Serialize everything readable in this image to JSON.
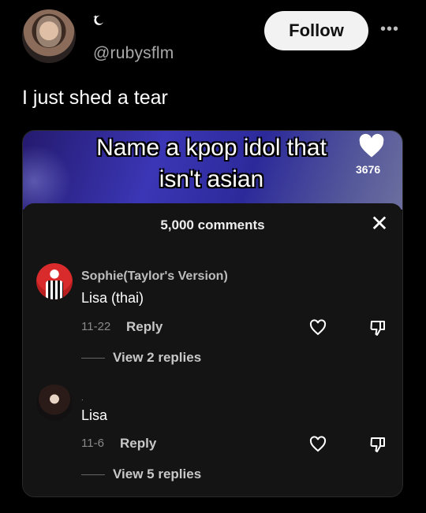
{
  "post": {
    "badge_icon": "moon-star-icon",
    "handle": "@rubysflm",
    "follow_label": "Follow",
    "more_label": "•••",
    "caption": "I just shed a tear"
  },
  "video": {
    "overlay_line1": "Name a kpop idol that",
    "overlay_line2": "isn't asian",
    "like_count": "3676"
  },
  "comments_panel": {
    "count_label": "5,000 comments",
    "close_label": "✕",
    "items": [
      {
        "name": "Sophie(Taylor's Version)",
        "text": "Lisa (thai)",
        "date": "11-22",
        "reply_label": "Reply",
        "view_replies": "View 2 replies"
      },
      {
        "name": ".",
        "text": "Lisa",
        "date": "11-6",
        "reply_label": "Reply",
        "view_replies": "View 5 replies"
      }
    ]
  },
  "colors": {
    "background": "#000000",
    "panel": "#141414",
    "follow_bg": "#f2f2f2",
    "muted_text": "#a8a8a8"
  }
}
